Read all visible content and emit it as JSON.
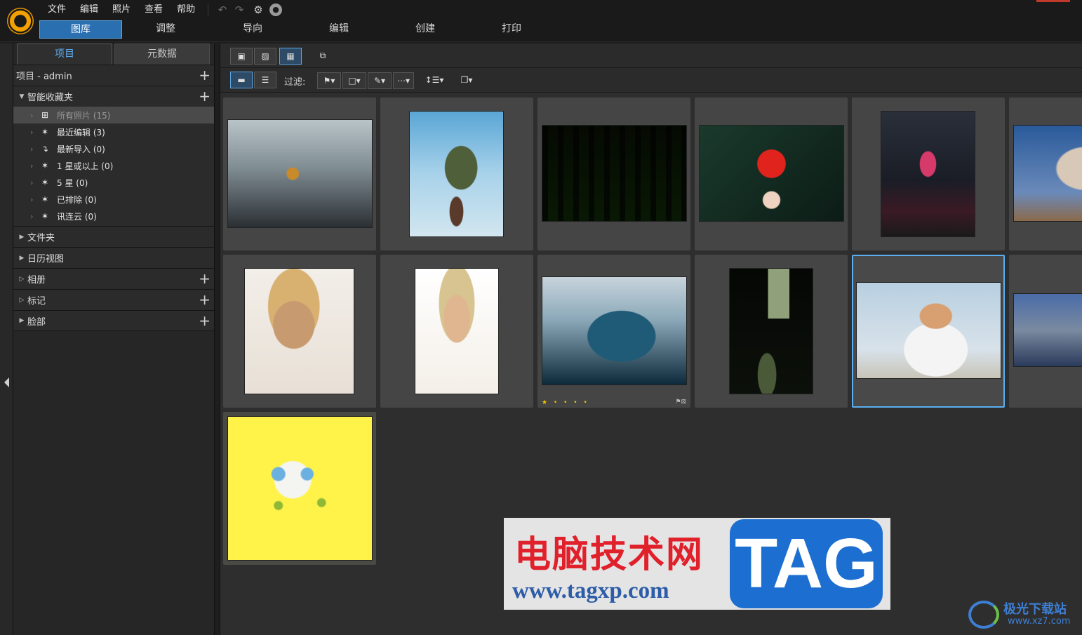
{
  "menu": [
    "文件",
    "编辑",
    "照片",
    "查看",
    "帮助"
  ],
  "modules": [
    "图库",
    "调整",
    "导向",
    "编辑",
    "创建",
    "打印"
  ],
  "sidebar": {
    "tabs": [
      "项目",
      "元数据"
    ],
    "project_row": "项目 - admin",
    "smart": "智能收藏夹",
    "smart_items": [
      "所有照片 (15)",
      "最近编辑 (3)",
      "最新导入 (0)",
      "1 星或以上 (0)",
      "5 星 (0)",
      "已排除 (0)",
      "讯连云 (0)"
    ],
    "sections": [
      "文件夹",
      "日历视图",
      "相册",
      "标记",
      "脸部"
    ]
  },
  "toolbar": {
    "filter_label": "过滤:"
  },
  "photos": [
    {
      "subject": "basketball-dunk",
      "colors": [
        "#9aa7ad",
        "#2b2f33",
        "#c98a2a"
      ]
    },
    {
      "subject": "rock-island-boat",
      "colors": [
        "#6fb0d8",
        "#5a6a4a",
        "#d2e6ef"
      ]
    },
    {
      "subject": "forest",
      "colors": [
        "#1f2d16",
        "#4a8a2a",
        "#0c120a"
      ]
    },
    {
      "subject": "maple-leaf",
      "colors": [
        "#12261e",
        "#e0231c",
        "#1a3a2c"
      ]
    },
    {
      "subject": "cafe-neon",
      "colors": [
        "#1a1d26",
        "#d63a6a",
        "#2a2f3a"
      ]
    },
    {
      "subject": "smoke-cloud",
      "colors": [
        "#2a5a9a",
        "#c8b8a8",
        "#8a7a6a"
      ]
    },
    {
      "subject": "smiling-woman",
      "colors": [
        "#f2eee8",
        "#c89a70",
        "#e8e0d6"
      ]
    },
    {
      "subject": "laughing-woman",
      "colors": [
        "#ffffff",
        "#e0b690",
        "#d8c4a8"
      ]
    },
    {
      "subject": "ocean-wave",
      "colors": [
        "#c8d4dc",
        "#1f5a76",
        "#0c2a3a"
      ]
    },
    {
      "subject": "dark-window",
      "colors": [
        "#050705",
        "#8fa07a",
        "#1a2014"
      ]
    },
    {
      "subject": "woman-portrait",
      "colors": [
        "#b8cfe0",
        "#f4f4f4",
        "#c8a070"
      ]
    },
    {
      "subject": "panorama",
      "colors": [
        "#4a6ca8",
        "#7a8aa0",
        "#2a3a5a"
      ]
    },
    {
      "subject": "sponge-face",
      "colors": [
        "#fff34a",
        "#8fb836",
        "#3a3a3a"
      ]
    }
  ],
  "wave_rating": "★ • • • •",
  "watermark": {
    "title": "电脑技术网",
    "url": "www.tagxp.com",
    "tag": "TAG",
    "site2": "极光下载站",
    "site2_url": "www.xz7.com"
  }
}
